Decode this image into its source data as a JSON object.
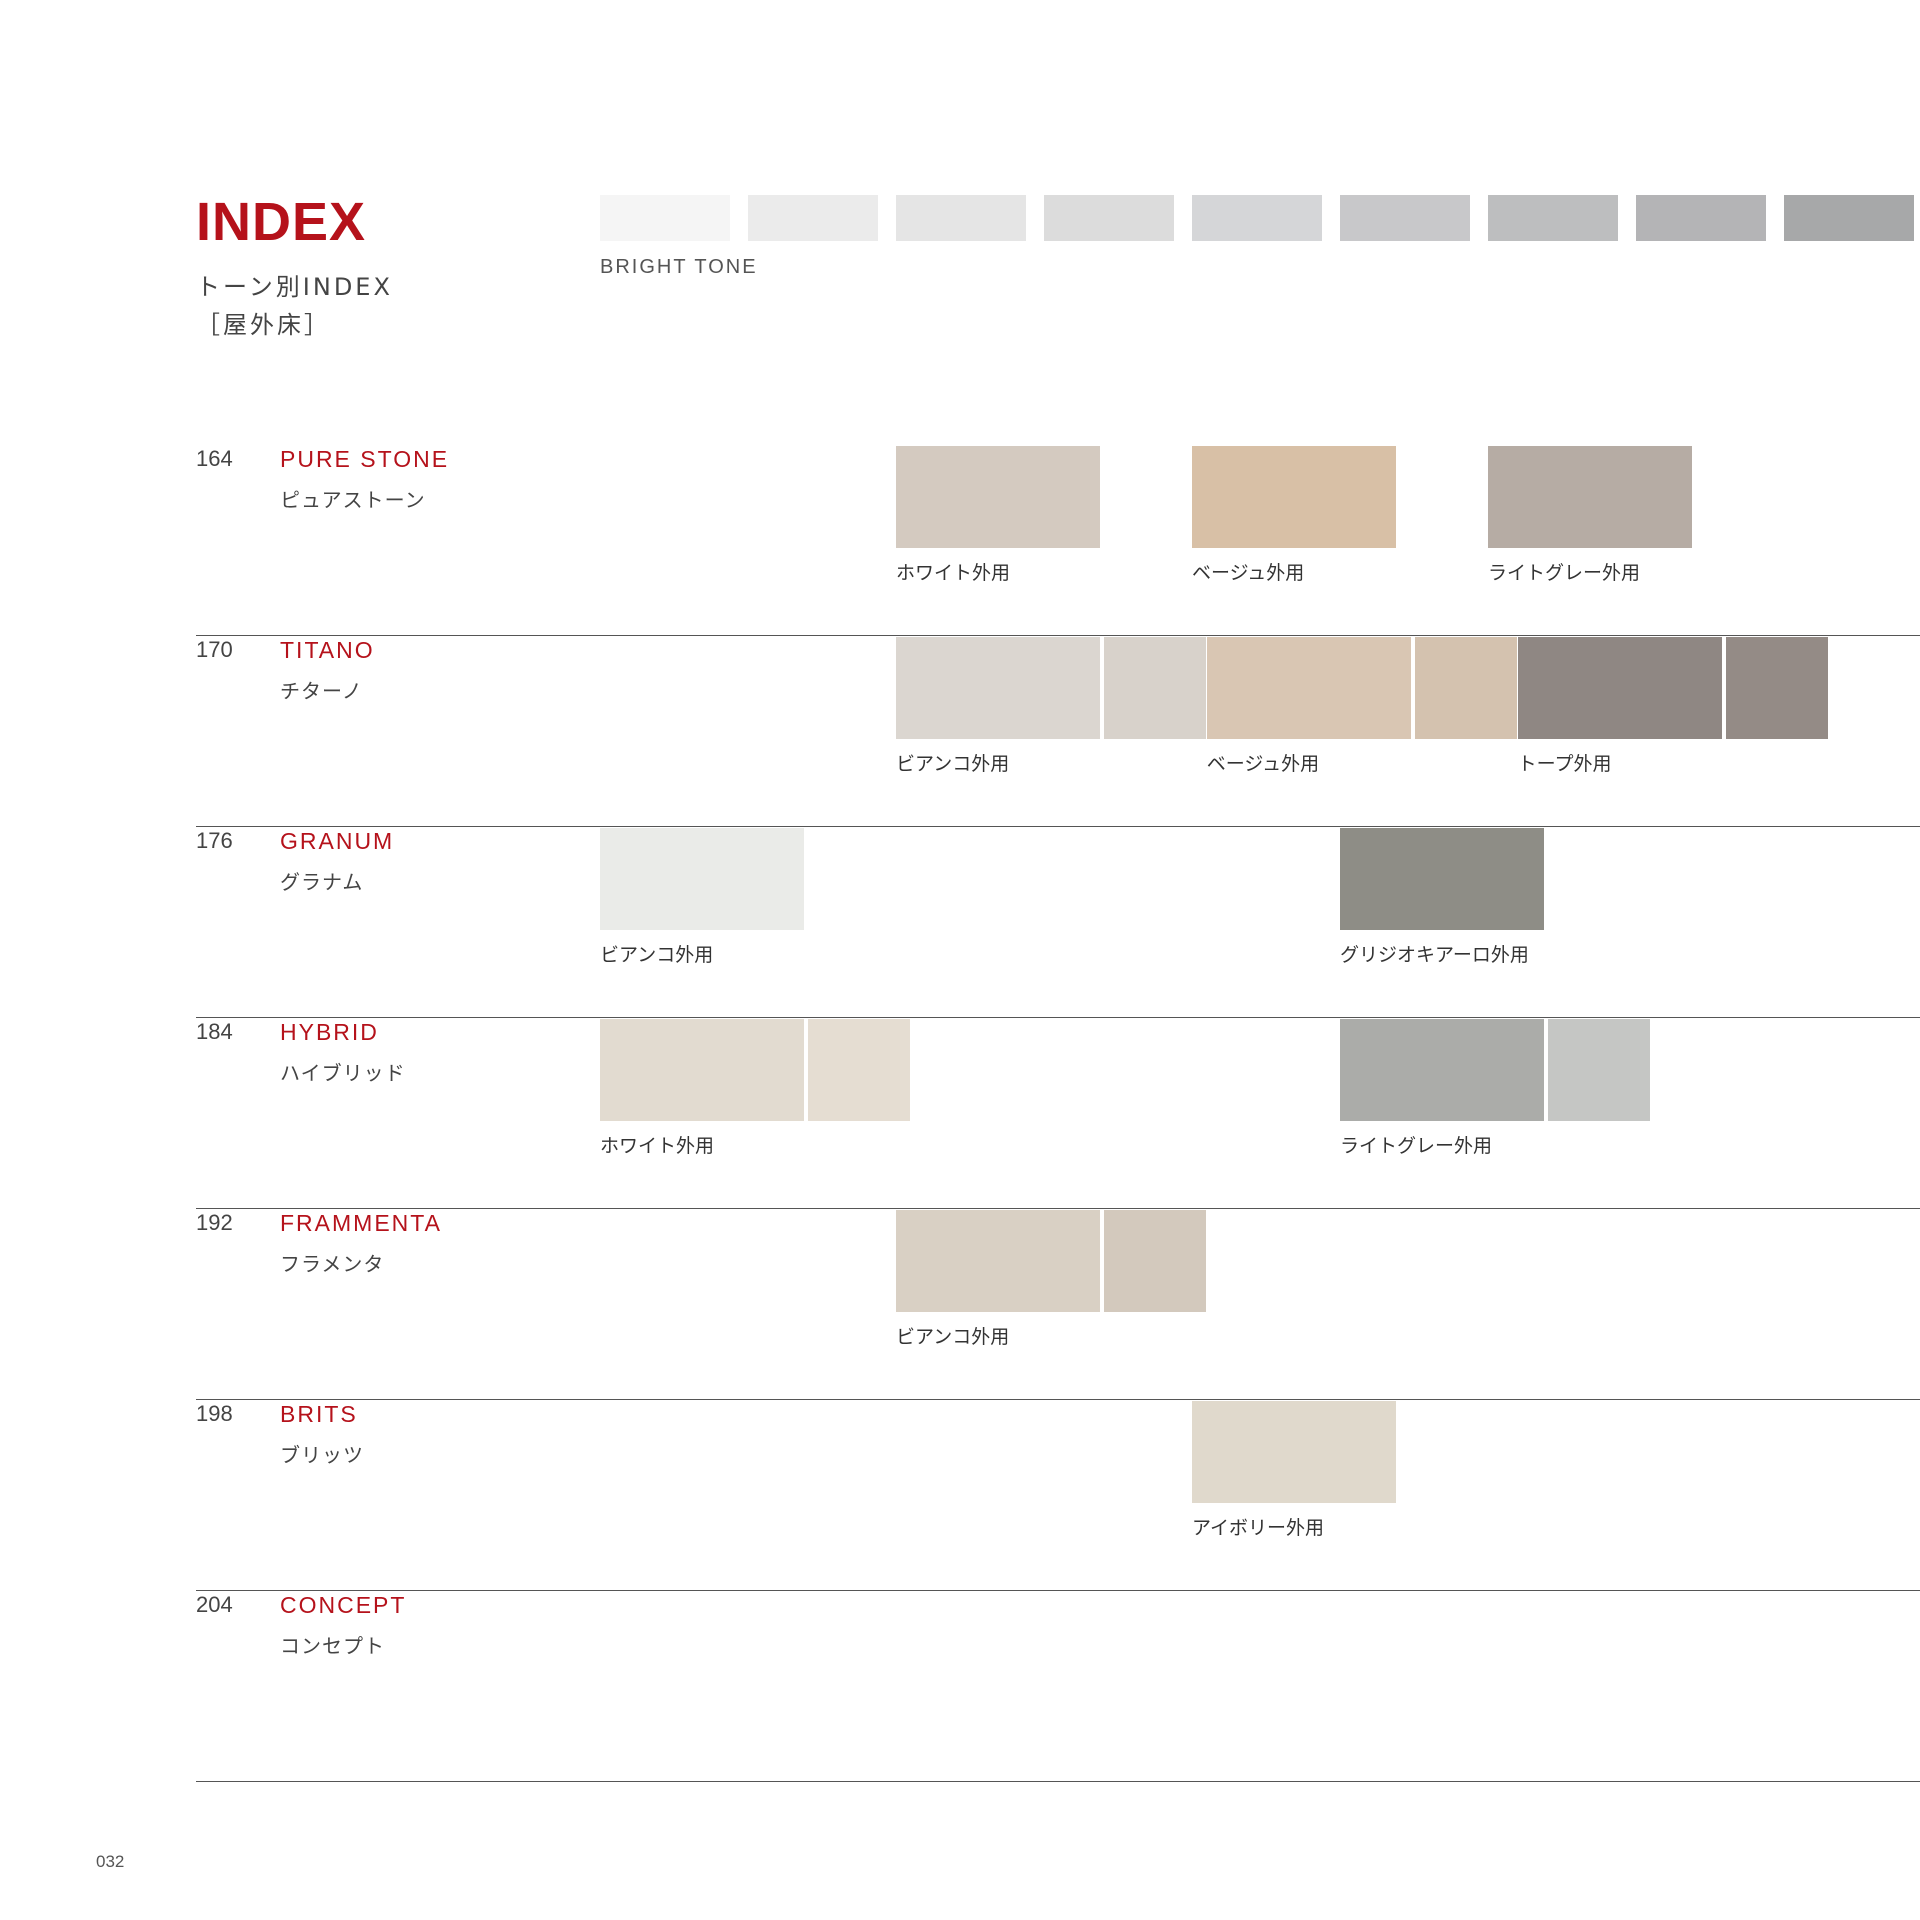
{
  "header": {
    "title": "INDEX",
    "subtitle_line1": "トーン別INDEX",
    "subtitle_line2": "［屋外床］"
  },
  "tone_scale": {
    "label": "BRIGHT TONE",
    "swatch_colors": [
      "#f5f5f5",
      "#ebebeb",
      "#e5e5e5",
      "#dcdcdc",
      "#d5d6d8",
      "#c8c8ca",
      "#bdbebf",
      "#b4b4b6",
      "#a7a8a9"
    ]
  },
  "rows": [
    {
      "page": "164",
      "name": "PURE STONE",
      "kana": "ピュアストーン",
      "groups": [
        {
          "slot": 3,
          "label": "ホワイト外用",
          "colors": [
            "#d4cac0"
          ]
        },
        {
          "slot": 5,
          "label": "ベージュ外用",
          "colors": [
            "#d8c0a6"
          ]
        },
        {
          "slot": 7,
          "label": "ライトグレー外用",
          "colors": [
            "#b6aca4"
          ]
        }
      ]
    },
    {
      "page": "170",
      "name": "TITANO",
      "kana": "チターノ",
      "groups": [
        {
          "slot": 3,
          "label": "ビアンコ外用",
          "colors": [
            "#dbd6d0",
            "#d8d2cb"
          ]
        },
        {
          "slot": 5.1,
          "label": "ベージュ外用",
          "colors": [
            "#d9c6b3",
            "#d4c2af"
          ]
        },
        {
          "slot": 7.2,
          "label": "トープ外用",
          "colors": [
            "#8f8783",
            "#948b86"
          ]
        }
      ]
    },
    {
      "page": "176",
      "name": "GRANUM",
      "kana": "グラナム",
      "groups": [
        {
          "slot": 1,
          "label": "ビアンコ外用",
          "colors": [
            "#eaebe8"
          ]
        },
        {
          "slot": 6,
          "label": "グリジオキアーロ外用",
          "colors": [
            "#8e8d86"
          ]
        }
      ]
    },
    {
      "page": "184",
      "name": "HYBRID",
      "kana": "ハイブリッド",
      "groups": [
        {
          "slot": 1,
          "label": "ホワイト外用",
          "colors": [
            "#e2dbd0",
            "#e5ddd2"
          ]
        },
        {
          "slot": 6,
          "label": "ライトグレー外用",
          "colors": [
            "#abaca9",
            "#c5c6c4"
          ]
        }
      ]
    },
    {
      "page": "192",
      "name": "FRAMMENTA",
      "kana": "フラメンタ",
      "groups": [
        {
          "slot": 3,
          "label": "ビアンコ外用",
          "colors": [
            "#d9d0c4",
            "#d3c9bd"
          ]
        }
      ]
    },
    {
      "page": "198",
      "name": "BRITS",
      "kana": "ブリッツ",
      "groups": [
        {
          "slot": 5,
          "label": "アイボリー外用",
          "colors": [
            "#e0d9cc"
          ]
        }
      ]
    },
    {
      "page": "204",
      "name": "CONCEPT",
      "kana": "コンセプト",
      "groups": []
    }
  ],
  "footer": {
    "page_number": "032"
  }
}
